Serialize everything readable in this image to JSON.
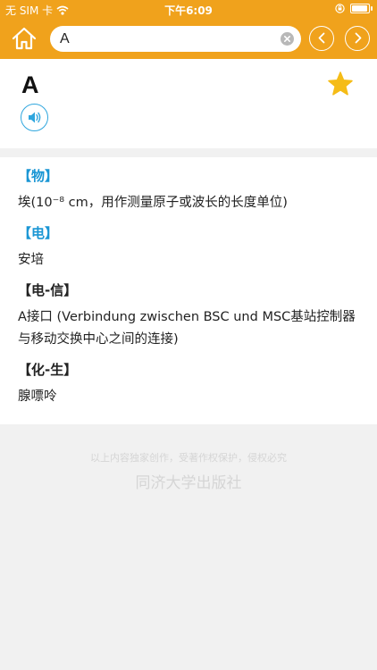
{
  "status_bar": {
    "carrier": "无 SIM 卡",
    "time": "下午6:09",
    "battery_level": 0.85
  },
  "toolbar": {
    "search_value": "A",
    "icons": [
      "home-icon",
      "clear-icon",
      "back-arrow-icon",
      "forward-arrow-icon"
    ]
  },
  "entry": {
    "headword": "A",
    "icons": [
      "star-icon",
      "speaker-icon"
    ],
    "senses": [
      {
        "label": "【物】",
        "definition": "埃(10⁻⁸ cm，用作测量原子或波长的长度单位)"
      },
      {
        "label": "【电】",
        "definition": "安培"
      },
      {
        "label": "【电-信】",
        "definition": "A接口 (Verbindung zwischen BSC und MSC基站控制器与移动交换中心之间的连接)"
      },
      {
        "label": "【化-生】",
        "definition": "腺嘌呤"
      }
    ]
  },
  "footer": {
    "notice": "以上内容独家创作，受著作权保护，侵权必究",
    "publisher": "同济大学出版社"
  },
  "colors": {
    "toolbar": "#f0a21c",
    "accent_blue": "#1a96d4",
    "star": "#f5bc17"
  }
}
